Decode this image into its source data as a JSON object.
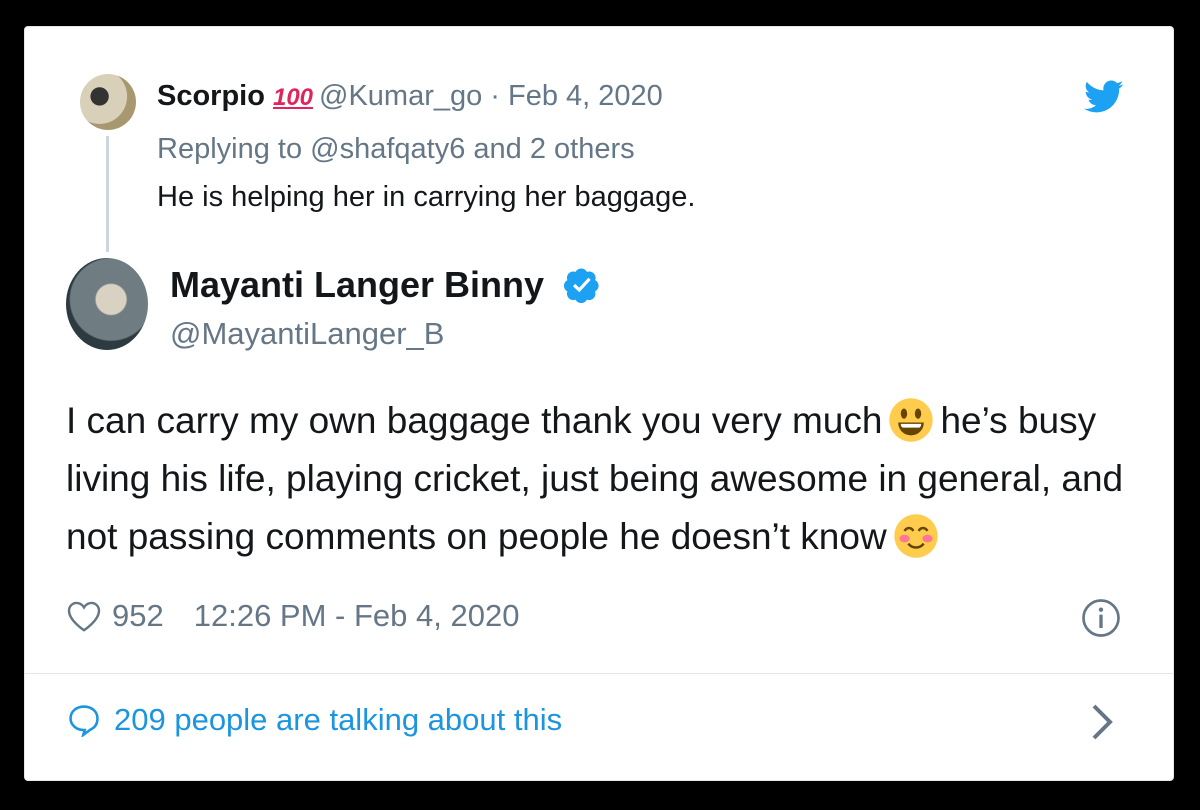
{
  "reply": {
    "name": "Scorpio",
    "emoji": "100",
    "handle_date": "@Kumar_go · Feb 4, 2020",
    "replying_to": "Replying to @shafqaty6 and 2 others",
    "text": "He is helping her in carrying her baggage."
  },
  "tweet": {
    "author_name": "Mayanti Langer Binny",
    "author_handle": "@MayantiLanger_B",
    "text_part1": "I can carry my own baggage thank you very much",
    "text_part2": "he’s busy living his life, playing cricket, just being awesome in general, and not passing comments on people he doesn’t know",
    "likes": "952",
    "timestamp": "12:26 PM - Feb 4, 2020"
  },
  "footer": {
    "talking": "209 people are talking about this"
  },
  "colors": {
    "twitter_blue": "#1da1f2",
    "link_blue": "#1b95e0",
    "secondary_text": "#657786",
    "primary_text": "#14171a"
  },
  "icons": [
    "twitter-bird-icon",
    "verified-badge-icon",
    "smiley-emoji-icon",
    "blush-emoji-icon",
    "heart-icon",
    "info-icon",
    "speech-bubble-icon",
    "chevron-right-icon"
  ]
}
